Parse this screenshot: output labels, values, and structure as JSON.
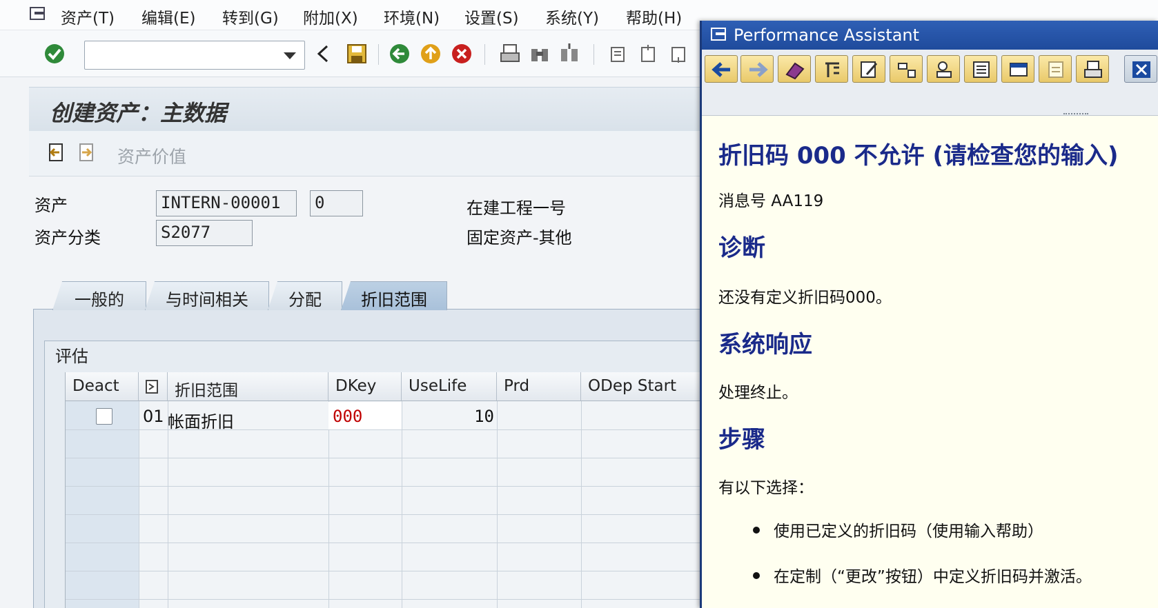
{
  "menu": [
    "资产(T)",
    "编辑(E)",
    "转到(G)",
    "附加(X)",
    "环境(N)",
    "设置(S)",
    "系统(Y)",
    "帮助(H)"
  ],
  "toolbar": {
    "command_value": ""
  },
  "page_title": "创建资产：主数据",
  "app_toolbar": {
    "asset_value_label": "资产价值"
  },
  "header": {
    "asset_label": "资产",
    "asset_number": "INTERN-00001",
    "asset_sub_number": "0",
    "asset_description": "在建工程一号",
    "asset_class_label": "资产分类",
    "asset_class": "S2077",
    "asset_class_description": "固定资产-其他"
  },
  "tabs": [
    "一般的",
    "与时间相关",
    "分配",
    "折旧范围"
  ],
  "active_tab": "折旧范围",
  "group_title": "评估",
  "table": {
    "columns": [
      "Deact",
      "折旧范围",
      "DKey",
      "UseLife",
      "Prd",
      "ODep Start"
    ],
    "rows": [
      {
        "deact": false,
        "area_no": "01",
        "area_name": "帐面折旧",
        "dkey": "000",
        "uselife": "10",
        "prd": "",
        "odep_start": ""
      }
    ]
  },
  "assistant": {
    "title": "Performance Assistant",
    "heading": "折旧码  000 不允许 (请检查您的输入)",
    "message_no": "消息号  AA119",
    "diagnosis_heading": "诊断",
    "diagnosis_text": "还没有定义折旧码000。",
    "system_response_heading": "系统响应",
    "system_response_text": "处理终止。",
    "procedure_heading": "步骤",
    "procedure_text": "有以下选择：",
    "procedure_items": [
      "使用已定义的折旧码（使用输入帮助）",
      "在定制（“更改”按钮）中定义折旧码并激活。"
    ]
  },
  "colors": {
    "accent_blue": "#1f4b9c",
    "heading_blue": "#1a2a8a",
    "error_red": "#c00000",
    "help_bg": "#fffff0"
  }
}
